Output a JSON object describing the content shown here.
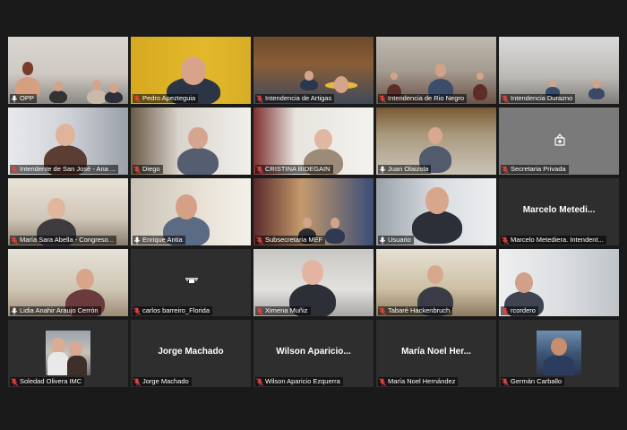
{
  "colors": {
    "background": "#1a1a1a",
    "active_speaker_border": "#e9e05a",
    "muted_mic": "#e0433d"
  },
  "participants": [
    {
      "name": "OPP",
      "muted": false,
      "mode": "video"
    },
    {
      "name": "Pedro Apezteguia",
      "muted": true,
      "mode": "video"
    },
    {
      "name": "Intendencia de Artigas",
      "muted": true,
      "mode": "video"
    },
    {
      "name": "Intendencia de Rio Negro",
      "muted": true,
      "mode": "video"
    },
    {
      "name": "Intendencia Durazno",
      "muted": true,
      "mode": "video"
    },
    {
      "name": "Intendente de San José - Ana ...",
      "muted": true,
      "mode": "video"
    },
    {
      "name": "Diego",
      "muted": true,
      "mode": "video"
    },
    {
      "name": "CRISTINA BIDEGAIN",
      "muted": true,
      "mode": "video"
    },
    {
      "name": "Juan Olaizola",
      "muted": false,
      "mode": "video"
    },
    {
      "name": "Secretaria Privada",
      "muted": true,
      "mode": "icon",
      "icon": "camera-placeholder-icon"
    },
    {
      "name": "María Sara Abella - Congreso...",
      "muted": true,
      "mode": "video"
    },
    {
      "name": "Enrique Antia",
      "muted": false,
      "mode": "video"
    },
    {
      "name": "Subsecretaria MEF",
      "muted": true,
      "mode": "video"
    },
    {
      "name": "Usuario",
      "muted": false,
      "mode": "video",
      "active": true
    },
    {
      "name": "Marcelo Metediera. Intendent...",
      "muted": true,
      "mode": "name",
      "big_name": "Marcelo Metedi..."
    },
    {
      "name": "Lidia Anahir Araujo Cerrón",
      "muted": false,
      "mode": "video"
    },
    {
      "name": "carlos barreiro_Florida",
      "muted": true,
      "mode": "icon",
      "icon": "drone-icon"
    },
    {
      "name": "Ximena Muñiz",
      "muted": true,
      "mode": "video"
    },
    {
      "name": "Tabaré Hackenbruch",
      "muted": true,
      "mode": "video"
    },
    {
      "name": "rcordero",
      "muted": true,
      "mode": "video"
    },
    {
      "name": "Soledad Olivera IMC",
      "muted": true,
      "mode": "photo"
    },
    {
      "name": "Jorge Machado",
      "muted": true,
      "mode": "name",
      "big_name": "Jorge Machado"
    },
    {
      "name": "Wilson Aparicio Ezquerra",
      "muted": true,
      "mode": "name",
      "big_name": "Wilson Aparicio..."
    },
    {
      "name": "María Noel Hernández",
      "muted": true,
      "mode": "name",
      "big_name": "María Noel Her..."
    },
    {
      "name": "Germán Carballo",
      "muted": true,
      "mode": "photo"
    }
  ]
}
